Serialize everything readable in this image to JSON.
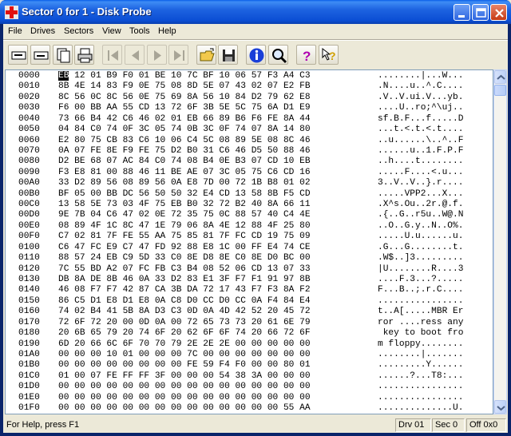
{
  "window": {
    "title": "Sector 0 for 1 - Disk Probe"
  },
  "menu": {
    "items": [
      {
        "label": "File"
      },
      {
        "label": "Drives"
      },
      {
        "label": "Sectors"
      },
      {
        "label": "View"
      },
      {
        "label": "Tools"
      },
      {
        "label": "Help"
      }
    ]
  },
  "toolbar": {
    "buttons": [
      "read-icon",
      "write-icon",
      "copy-icon",
      "print-icon",
      "first-icon",
      "prev-icon",
      "next-icon",
      "last-icon",
      "open-icon",
      "save-icon",
      "info-icon",
      "search-icon",
      "help-icon",
      "context-help-icon"
    ]
  },
  "hex": {
    "rows": [
      {
        "off": "0000",
        "hex": "EB 12 01 B9 F0 01 BE 10 7C BF 10 06 57 F3 A4 C3",
        "asc": "........|...W..."
      },
      {
        "off": "0010",
        "hex": "8B 4E 14 83 F9 0E 75 08 8D 5E 07 43 02 07 E2 FB",
        "asc": ".N....u..^.C...."
      },
      {
        "off": "0020",
        "hex": "8C 56 0C 8C 56 0E 75 69 8A 56 10 84 D2 79 62 E8",
        "asc": ".V..V.ui.V...yb."
      },
      {
        "off": "0030",
        "hex": "F6 00 BB AA 55 CD 13 72 6F 3B 5E 5C 75 6A D1 E9",
        "asc": "....U..ro;^\\uj.."
      },
      {
        "off": "0040",
        "hex": "73 66 B4 42 C6 46 02 01 EB 66 89 B6 F6 FE 8A 44",
        "asc": "sf.B.F...f.....D"
      },
      {
        "off": "0050",
        "hex": "04 84 C0 74 0F 3C 05 74 0B 3C 0F 74 07 8A 14 80",
        "asc": "...t.<.t.<.t...."
      },
      {
        "off": "0060",
        "hex": "E2 80 75 CB 83 C6 10 06 C4 5C 08 89 5E 08 8C 46",
        "asc": "..u......\\..^..F"
      },
      {
        "off": "0070",
        "hex": "0A 07 FE 8E F9 FE 75 D2 B0 31 C6 46 D5 50 88 46",
        "asc": "......u..1.F.P.F"
      },
      {
        "off": "0080",
        "hex": "D2 BE 68 07 AC 84 C0 74 08 B4 0E B3 07 CD 10 EB",
        "asc": "..h....t........"
      },
      {
        "off": "0090",
        "hex": "F3 E8 81 00 88 46 11 BE AE 07 3C 05 75 C6 CD 16",
        "asc": ".....F....<.u..."
      },
      {
        "off": "00A0",
        "hex": "33 D2 89 56 08 89 56 0A E8 7D 00 72 1B B8 01 02",
        "asc": "3..V..V..}.r...."
      },
      {
        "off": "00B0",
        "hex": "BF 05 00 BB DC 56 50 50 32 E4 CD 13 58 8B F5 CD",
        "asc": ".....VPP2...X..."
      },
      {
        "off": "00C0",
        "hex": "13 58 5E 73 03 4F 75 EB B0 32 72 B2 40 8A 66 11",
        "asc": ".X^s.Ou..2r.@.f."
      },
      {
        "off": "00D0",
        "hex": "9E 7B 04 C6 47 02 0E 72 35 75 0C 88 57 40 C4 4E",
        "asc": ".{..G..r5u..W@.N"
      },
      {
        "off": "00E0",
        "hex": "08 89 4F 1C 8C 47 1E 79 06 8A 4E 12 88 4F 25 80",
        "asc": "..O..G.y..N..O%."
      },
      {
        "off": "00F0",
        "hex": "C7 02 81 7F FE 55 AA 75 85 81 7F FC CD 19 75 09",
        "asc": ".....U.u......u."
      },
      {
        "off": "0100",
        "hex": "C6 47 FC E9 C7 47 FD 92 88 E8 1C 00 FF E4 74 CE",
        "asc": ".G...G........t."
      },
      {
        "off": "0110",
        "hex": "88 57 24 EB C9 5D 33 C0 8E D8 8E C0 8E D0 BC 00",
        "asc": ".W$..]3........."
      },
      {
        "off": "0120",
        "hex": "7C 55 BD A2 07 FC FB C3 B4 08 52 06 CD 13 07 33",
        "asc": "|U........R....3"
      },
      {
        "off": "0130",
        "hex": "DB 8A DE 8B 46 0A 33 D2 83 E1 3F F7 F1 91 97 8B",
        "asc": "....F.3...?....."
      },
      {
        "off": "0140",
        "hex": "46 08 F7 F7 42 87 CA 3B DA 72 17 43 F7 F3 8A F2",
        "asc": "F...B..;.r.C...."
      },
      {
        "off": "0150",
        "hex": "86 C5 D1 E8 D1 E8 0A C8 D0 CC D0 CC 0A F4 84 E4",
        "asc": "................"
      },
      {
        "off": "0160",
        "hex": "74 02 B4 41 5B 8A D3 C3 0D 0A 4D 42 52 20 45 72",
        "asc": "t..A[.....MBR Er"
      },
      {
        "off": "0170",
        "hex": "72 6F 72 20 00 0D 0A 00 72 65 73 73 20 61 6E 79",
        "asc": "ror ....ress any"
      },
      {
        "off": "0180",
        "hex": "20 6B 65 79 20 74 6F 20 62 6F 6F 74 20 66 72 6F",
        "asc": " key to boot fro"
      },
      {
        "off": "0190",
        "hex": "6D 20 66 6C 6F 70 70 79 2E 2E 2E 00 00 00 00 00",
        "asc": "m floppy........"
      },
      {
        "off": "01A0",
        "hex": "00 00 00 10 01 00 00 00 7C 00 00 00 00 00 00 00",
        "asc": "........|......."
      },
      {
        "off": "01B0",
        "hex": "00 00 00 00 00 00 00 00 FE 59 F4 F0 00 00 80 01",
        "asc": ".........Y......"
      },
      {
        "off": "01C0",
        "hex": "01 00 07 FE FF FF 3F 00 00 00 54 38 3A 00 00 00",
        "asc": "......?...T8:..."
      },
      {
        "off": "01D0",
        "hex": "00 00 00 00 00 00 00 00 00 00 00 00 00 00 00 00",
        "asc": "................"
      },
      {
        "off": "01E0",
        "hex": "00 00 00 00 00 00 00 00 00 00 00 00 00 00 00 00",
        "asc": "................"
      },
      {
        "off": "01F0",
        "hex": "00 00 00 00 00 00 00 00 00 00 00 00 00 00 55 AA",
        "asc": "..............U."
      }
    ],
    "cursor_byte": "EB"
  },
  "status": {
    "help": "For Help, press F1",
    "drive": "Drv  01",
    "sector": "Sec 0",
    "offset": "Off 0x0"
  },
  "colors": {
    "title_bar": "#0A5FE8",
    "cursor_bg": "#000000"
  }
}
